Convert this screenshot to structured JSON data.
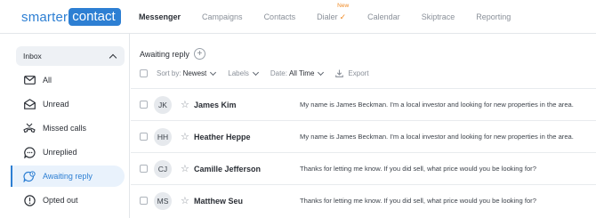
{
  "logo": {
    "word1": "smarter",
    "word2": "contact"
  },
  "nav": {
    "items": [
      {
        "label": "Messenger",
        "active": true
      },
      {
        "label": "Campaigns"
      },
      {
        "label": "Contacts"
      },
      {
        "label": "Dialer",
        "badge": "New"
      },
      {
        "label": "Calendar"
      },
      {
        "label": "Skiptrace"
      },
      {
        "label": "Reporting"
      }
    ]
  },
  "sidebar": {
    "header": "Inbox",
    "items": [
      {
        "label": "All",
        "icon": "envelope-icon"
      },
      {
        "label": "Unread",
        "icon": "unread-envelope-icon"
      },
      {
        "label": "Missed calls",
        "icon": "missed-call-icon"
      },
      {
        "label": "Unreplied",
        "icon": "chat-bubble-icon"
      },
      {
        "label": "Awaiting reply",
        "icon": "awaiting-chat-icon",
        "active": true
      },
      {
        "label": "Opted out",
        "icon": "exclamation-circle-icon"
      }
    ]
  },
  "main": {
    "title": "Awaiting reply",
    "filters": {
      "sort_label": "Sort by:",
      "sort_value": "Newest",
      "labels": "Labels",
      "date_label": "Date:",
      "date_value": "All Time",
      "export": "Export"
    },
    "conversations": [
      {
        "initials": "JK",
        "name": "James Kim",
        "message": "My name is James Beckman. I'm a local investor and looking for new properties in the area."
      },
      {
        "initials": "HH",
        "name": "Heather Heppe",
        "message": "My name is James Beckman. I'm a local investor and looking for new properties in the area."
      },
      {
        "initials": "CJ",
        "name": "Camille Jefferson",
        "message": "Thanks for letting me know. If you did sell, what price would you be looking for?"
      },
      {
        "initials": "MS",
        "name": "Matthew Seu",
        "message": "Thanks for letting me know. If you did sell, what price would you be looking for?"
      }
    ]
  },
  "colors": {
    "accent": "#2d7fd3",
    "new_badge": "#f08a24",
    "active_bg": "#e9f2fc"
  }
}
